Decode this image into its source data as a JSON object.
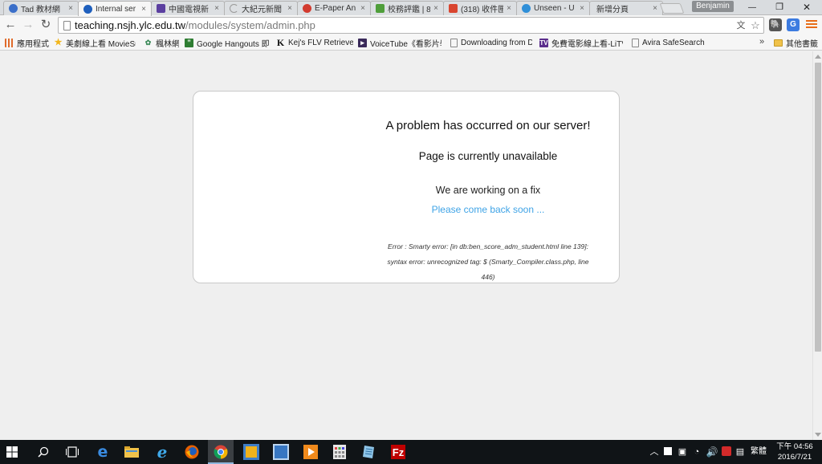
{
  "browser": {
    "tabs": [
      {
        "title": "Tad 教材網",
        "favicon_color": "#3b6fc9",
        "active": false
      },
      {
        "title": "Internal ser",
        "favicon_color": "#1f5fbd",
        "active": true
      },
      {
        "title": "中國電視新",
        "favicon_color": "#5b3fa0",
        "active": false
      },
      {
        "title": "大紀元新聞",
        "favicon_color": "#9a9a9a",
        "active": false
      },
      {
        "title": "E-Paper An",
        "favicon_color": "#d23b2f",
        "active": false
      },
      {
        "title": "校務評鑑 | 8",
        "favicon_color": "#4f9e3a",
        "active": false
      },
      {
        "title": "(318) 收件匣",
        "favicon_color": "#d9452f",
        "active": false
      },
      {
        "title": "Unseen - U",
        "favicon_color": "#2f8fd8",
        "active": false
      },
      {
        "title": "新增分頁",
        "favicon_color": "",
        "active": false
      }
    ],
    "tab_close_glyph": "×",
    "profile_name": "Benjamin",
    "window_controls": {
      "minimize": "—",
      "restore": "❐",
      "close": "✕"
    },
    "nav": {
      "back": "←",
      "forward": "→",
      "reload": "↻"
    },
    "url_host": "teaching.nsjh.ylc.edu.tw",
    "url_path": "/modules/system/admin.php",
    "bookmarks": [
      {
        "label": "應用程式",
        "icon": "apps-grid-icon",
        "color": "#e06b2b"
      },
      {
        "label": "美劇線上看 MovieSu",
        "icon": "star-icon",
        "color": "#f2b61b"
      },
      {
        "label": "楓林網",
        "icon": "leaf-icon",
        "color": "#3d8b5a"
      },
      {
        "label": "Google Hangouts 即",
        "icon": "hangouts-icon",
        "color": "#2e7d32"
      },
      {
        "label": "Kej's FLV Retriever",
        "icon": "k-icon",
        "color": "#111111"
      },
      {
        "label": "VoiceTube《看影片學",
        "icon": "voicetube-icon",
        "color": "#3a2a5a"
      },
      {
        "label": "Downloading from D",
        "icon": "page-icon",
        "color": "#888888"
      },
      {
        "label": "免費電影線上看-LiTV",
        "icon": "litv-icon",
        "color": "#5b2d8c"
      },
      {
        "label": "Avira SafeSearch",
        "icon": "page-icon",
        "color": "#888888"
      }
    ],
    "bookmarks_overflow": "»",
    "other_bookmarks": "其他書籤"
  },
  "error_page": {
    "heading": "A problem has occurred on our server!",
    "subheading": "Page is currently unavailable",
    "working": "We are working on a fix",
    "come_back": "Please come back soon ...",
    "error_line1": "Error : Smarty error: [in db:ben_score_adm_student.html line 139]:",
    "error_line2": "syntax error: unrecognized tag: $ (Smarty_Compiler.class.php, line",
    "error_line3": "446)"
  },
  "taskbar": {
    "tray_ime": "繁體",
    "time": "下午 04:56",
    "date": "2016/7/21"
  },
  "colors": {
    "link": "#3ea3e6",
    "page_bg": "#efefef",
    "taskbar_bg": "#101417"
  }
}
